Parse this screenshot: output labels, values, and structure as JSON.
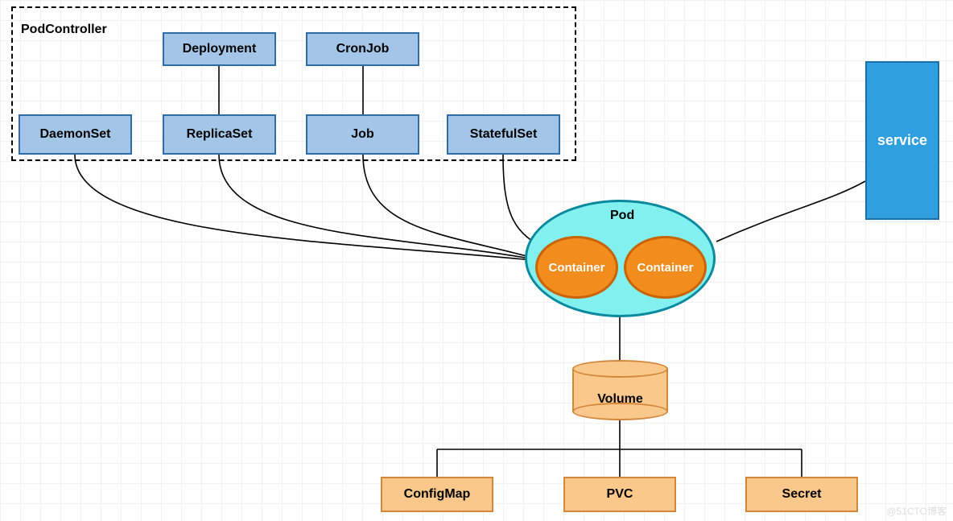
{
  "podcontroller": {
    "title": "PodController",
    "controllers": {
      "deployment": "Deployment",
      "cronjob": "CronJob",
      "daemonset": "DaemonSet",
      "replicaset": "ReplicaSet",
      "job": "Job",
      "statefulset": "StatefulSet"
    }
  },
  "pod": {
    "label": "Pod",
    "containers": [
      "Container",
      "Container"
    ]
  },
  "service": {
    "label": "service"
  },
  "volume": {
    "label": "Volume",
    "targets": {
      "configmap": "ConfigMap",
      "pvc": "PVC",
      "secret": "Secret"
    }
  },
  "watermark": "@51CTO博客"
}
